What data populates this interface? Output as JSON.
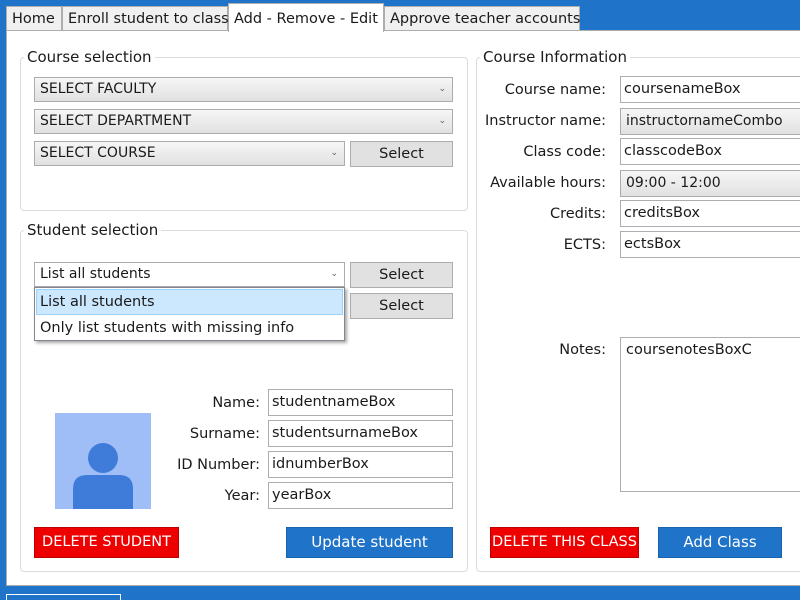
{
  "tabs": [
    {
      "label": "Home"
    },
    {
      "label": "Enroll student to class"
    },
    {
      "label": "Add - Remove - Edit"
    },
    {
      "label": "Approve teacher accounts"
    }
  ],
  "course_selection": {
    "title": "Course selection",
    "faculty_combo": "SELECT FACULTY",
    "department_combo": "SELECT DEPARTMENT",
    "course_combo": "SELECT COURSE",
    "select_button": "Select"
  },
  "student_selection": {
    "title": "Student selection",
    "filter_combo": "List all students",
    "select_button_1": "Select",
    "select_button_2": "Select",
    "dropdown_options": [
      "List all students",
      "Only list students with missing info"
    ],
    "fields": {
      "name_label": "Name:",
      "name_value": "studentnameBox",
      "surname_label": "Surname:",
      "surname_value": "studentsurnameBox",
      "id_label": "ID Number:",
      "id_value": "idnumberBox",
      "year_label": "Year:",
      "year_value": "yearBox"
    },
    "delete_button": "DELETE STUDENT",
    "update_button": "Update student"
  },
  "course_info": {
    "title": "Course Information",
    "course_name_label": "Course name:",
    "course_name_value": "coursenameBox",
    "instructor_label": "Instructor name:",
    "instructor_value": "instructornameCombo",
    "class_code_label": "Class code:",
    "class_code_value": "classcodeBox",
    "hours_label": "Available hours:",
    "hours_value": "09:00 - 12:00",
    "credits_label": "Credits:",
    "credits_value": "creditsBox",
    "ects_label": "ECTS:",
    "ects_value": "ectsBox",
    "notes_label": "Notes:",
    "notes_value": "coursenotesBoxC",
    "delete_button": "DELETE THIS CLASS",
    "add_button": "Add Class"
  },
  "icons": {
    "combo_arrow": "chevron-down-icon",
    "avatar": "user-avatar-icon"
  },
  "colors": {
    "accent_blue": "#1f73c8",
    "danger_red": "#ef0000",
    "selection_blue": "#cce8ff"
  }
}
